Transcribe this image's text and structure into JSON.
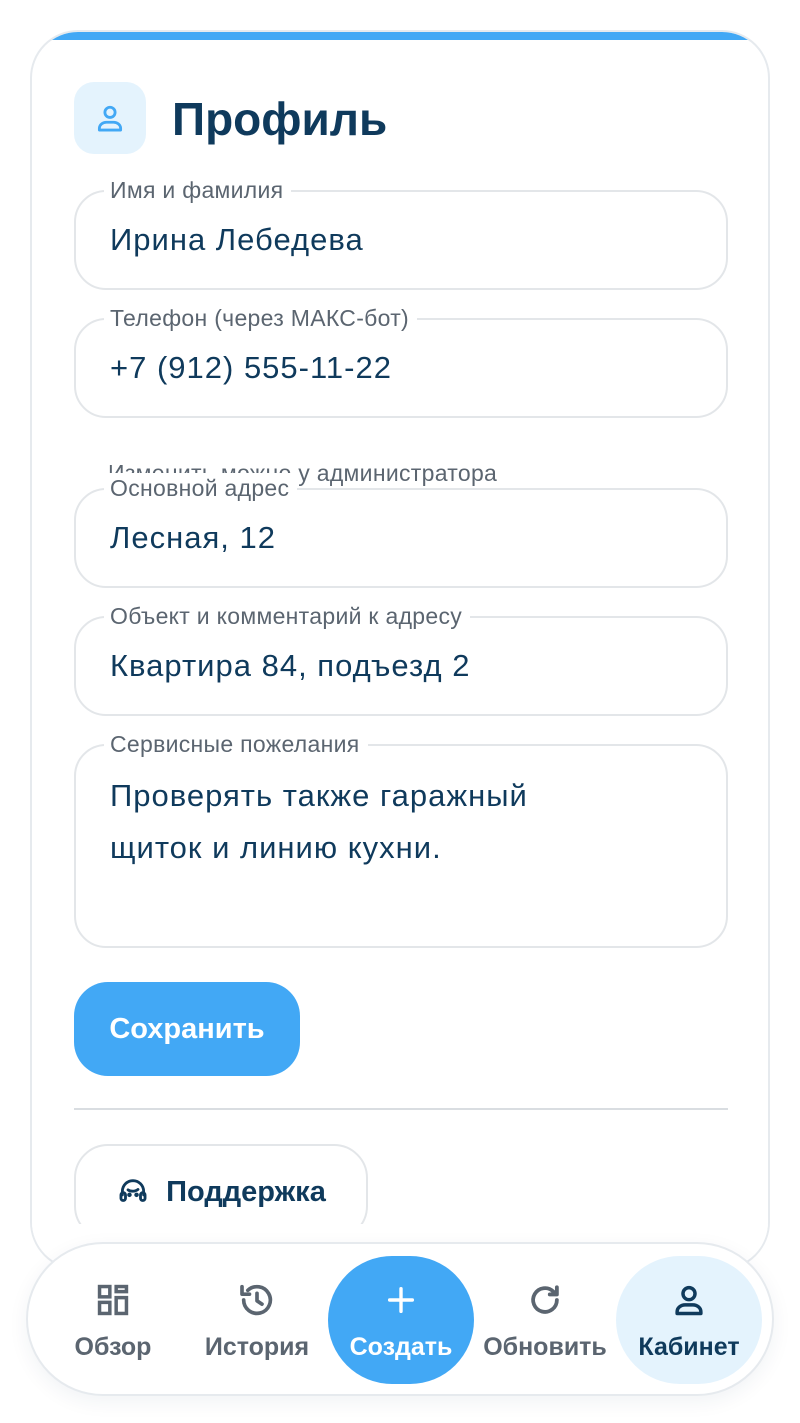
{
  "header": {
    "title": "Профиль",
    "icon": "user-icon"
  },
  "form": {
    "name": {
      "label": "Имя и фамилия",
      "value": "Ирина Лебедева"
    },
    "phone": {
      "label": "Телефон (через МАКС-бот)",
      "value": "+7 (912) 555-11-22",
      "hint": "Изменить можно у администратора"
    },
    "address": {
      "label": "Основной адрес",
      "value": "Лесная, 12"
    },
    "object": {
      "label": "Объект и комментарий к адресу",
      "value": "Квартира 84, подъезд 2"
    },
    "wishes": {
      "label": "Сервисные пожелания",
      "value": "Проверять также гаражный щиток и линию кухни."
    },
    "save_label": "Сохранить"
  },
  "support": {
    "label": "Поддержка",
    "icon": "headset-icon"
  },
  "nav": {
    "items": [
      {
        "label": "Обзор",
        "icon": "dashboard-icon"
      },
      {
        "label": "История",
        "icon": "history-icon"
      },
      {
        "label": "Создать",
        "icon": "plus-icon"
      },
      {
        "label": "Обновить",
        "icon": "refresh-icon"
      },
      {
        "label": "Кабинет",
        "icon": "user-icon"
      }
    ],
    "active": "Кабинет"
  },
  "colors": {
    "accent": "#42a8f5",
    "title": "#0f3a5c",
    "muted": "#5b6570",
    "icon_bg": "#e4f3fd"
  }
}
